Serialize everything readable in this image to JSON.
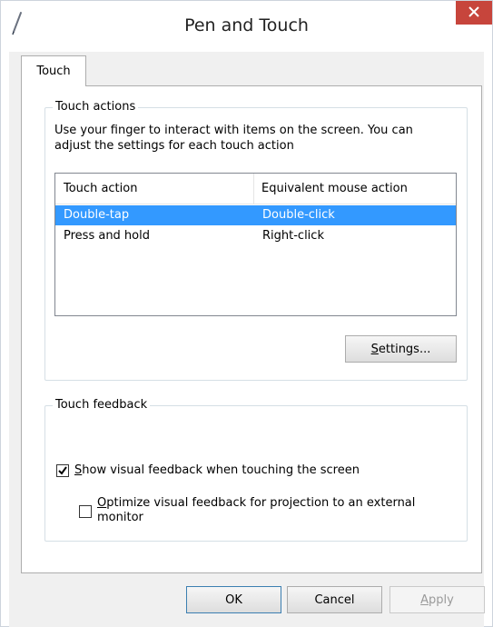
{
  "window": {
    "title": "Pen and Touch",
    "icon": "pen-icon",
    "close_icon": "close-icon"
  },
  "tabs": [
    {
      "label": "Touch",
      "selected": true
    }
  ],
  "touch_actions": {
    "group_label": "Touch actions",
    "description_line1": "Use your finger to interact with items on the screen. You can",
    "description_line2": "adjust the settings for each touch action",
    "columns": [
      "Touch action",
      "Equivalent mouse action"
    ],
    "rows": [
      {
        "action": "Double-tap",
        "mouse": "Double-click",
        "selected": true
      },
      {
        "action": "Press and hold",
        "mouse": "Right-click",
        "selected": false
      }
    ],
    "settings_button": {
      "mnemonic": "S",
      "rest": "ettings..."
    }
  },
  "touch_feedback": {
    "group_label": "Touch feedback",
    "show_visual": {
      "mnemonic": "S",
      "rest": "how visual feedback when touching the screen",
      "checked": true
    },
    "optimize": {
      "mnemonic": "O",
      "rest_line1": "ptimize visual feedback for projection to an external",
      "line2": "monitor",
      "checked": false
    }
  },
  "footer": {
    "ok_label": "OK",
    "cancel_label": "Cancel",
    "apply": {
      "mnemonic": "A",
      "rest": "pply",
      "enabled": false
    }
  },
  "colors": {
    "close_button": "#c7453c",
    "selection": "#3399ff",
    "default_button_border": "#3c7fb1"
  }
}
